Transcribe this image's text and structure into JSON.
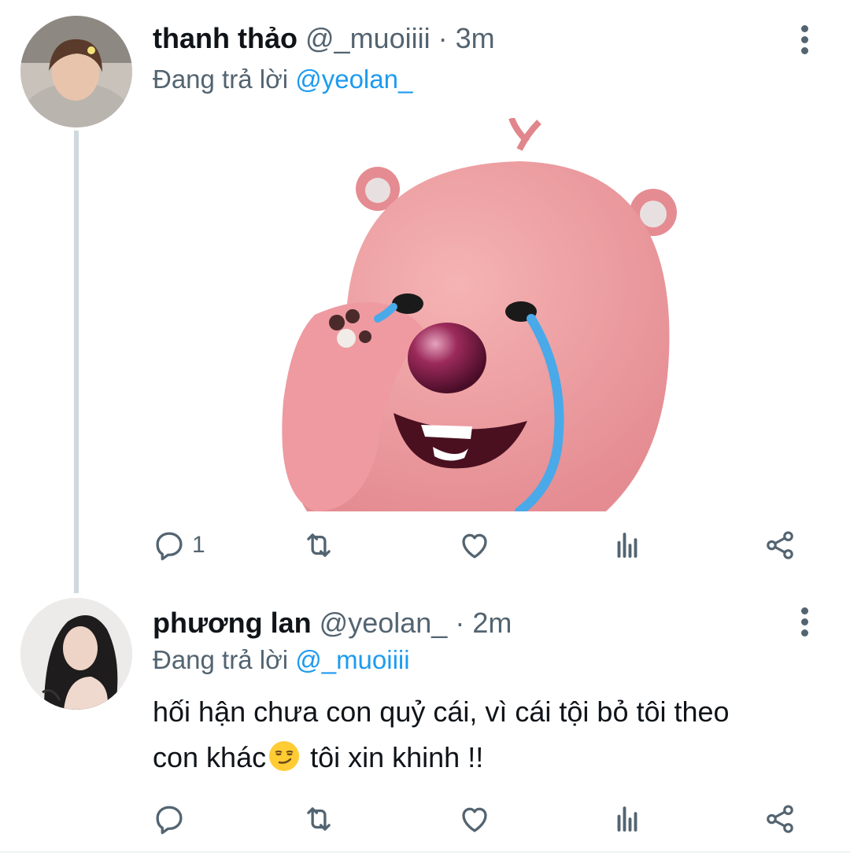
{
  "tweets": [
    {
      "display_name": "thanh thảo",
      "handle": "@_muoiiii",
      "separator": "·",
      "time": "3m",
      "reply_prefix": "Đang trả lời",
      "reply_to": "@yeolan_",
      "text": "",
      "reply_count": "1",
      "media": "pink beaver sticker crying"
    },
    {
      "display_name": "phương lan",
      "handle": "@yeolan_",
      "separator": "·",
      "time": "2m",
      "reply_prefix": "Đang trả lời",
      "reply_to": "@_muoiiii",
      "text_line1": "hối hận chưa con quỷ cái, vì cái tội bỏ tôi theo",
      "text_line2a": "con khác",
      "text_line2b": " tôi xin khinh !!",
      "reply_count": ""
    }
  ],
  "icons": [
    "reply-icon",
    "retweet-icon",
    "like-icon",
    "analytics-icon",
    "share-icon",
    "more-icon",
    "smirk-emoji"
  ],
  "colors": {
    "accent": "#1d9bf0",
    "muted": "#536471",
    "text": "#0f1419",
    "thread_line": "#cfd9de"
  }
}
